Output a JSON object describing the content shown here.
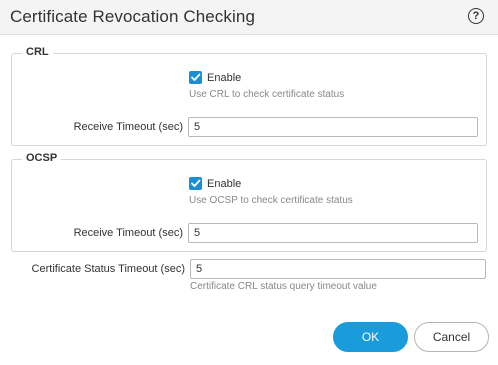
{
  "dialog": {
    "title": "Certificate Revocation Checking",
    "help_icon": "?"
  },
  "crl": {
    "legend": "CRL",
    "enable_label": "Enable",
    "enabled": true,
    "hint": "Use CRL to check certificate status",
    "timeout_label": "Receive Timeout (sec)",
    "timeout_value": "5"
  },
  "ocsp": {
    "legend": "OCSP",
    "enable_label": "Enable",
    "enabled": true,
    "hint": "Use OCSP to check certificate status",
    "timeout_label": "Receive Timeout (sec)",
    "timeout_value": "5"
  },
  "status_timeout": {
    "label": "Certificate Status Timeout (sec)",
    "value": "5",
    "hint": "Certificate CRL status query timeout value"
  },
  "buttons": {
    "ok": "OK",
    "cancel": "Cancel"
  },
  "colors": {
    "accent": "#1a9bdc",
    "checkbox": "#1a8fd6"
  }
}
